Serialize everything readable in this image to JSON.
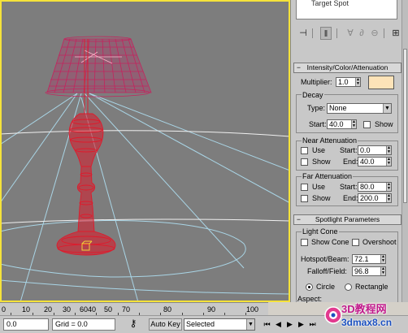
{
  "panel": {
    "object_list_item": "Target Spot",
    "rollout_intensity": {
      "title": "Intensity/Color/Attenuation",
      "multiplier_label": "Multiplier:",
      "multiplier_value": "1.0",
      "light_color": "#fde3b8",
      "decay": {
        "title": "Decay",
        "type_label": "Type:",
        "type_value": "None",
        "start_label": "Start:",
        "start_value": "40.0",
        "show_label": "Show"
      },
      "near_attenuation": {
        "title": "Near Attenuation",
        "use_label": "Use",
        "show_label": "Show",
        "start_label": "Start:",
        "start_value": "0.0",
        "end_label": "End:",
        "end_value": "40.0"
      },
      "far_attenuation": {
        "title": "Far Attenuation",
        "use_label": "Use",
        "show_label": "Show",
        "start_label": "Start:",
        "start_value": "80.0",
        "end_label": "End:",
        "end_value": "200.0"
      }
    },
    "rollout_spotlight": {
      "title": "Spotlight Parameters",
      "light_cone": {
        "title": "Light Cone",
        "show_cone_label": "Show Cone",
        "overshoot_label": "Overshoot",
        "hotspot_label": "Hotspot/Beam:",
        "hotspot_value": "72.1",
        "falloff_label": "Falloff/Field:",
        "falloff_value": "96.8",
        "circle_label": "Circle",
        "rectangle_label": "Rectangle",
        "aspect_label": "Aspect:"
      }
    }
  },
  "timeline": {
    "ticks": [
      "0",
      "10",
      "20",
      "30",
      "40",
      "50",
      "60",
      "70",
      "80",
      "90",
      "100"
    ]
  },
  "statusbar": {
    "coord_value": "0.0",
    "grid_label": "Grid = 0.0",
    "auto_key_label": "Auto Key",
    "selected_value": "Selected"
  },
  "watermark": {
    "line1": "3D教程网",
    "line2": "3dmax8.cn"
  },
  "colors": {
    "viewport_bg": "#7d7d7d",
    "viewport_border": "#f5e23a",
    "lamp_wireframe": "#e0192b",
    "shade_wireframe": "#c4245e",
    "light_cone_lines": "#a9d5e6"
  }
}
